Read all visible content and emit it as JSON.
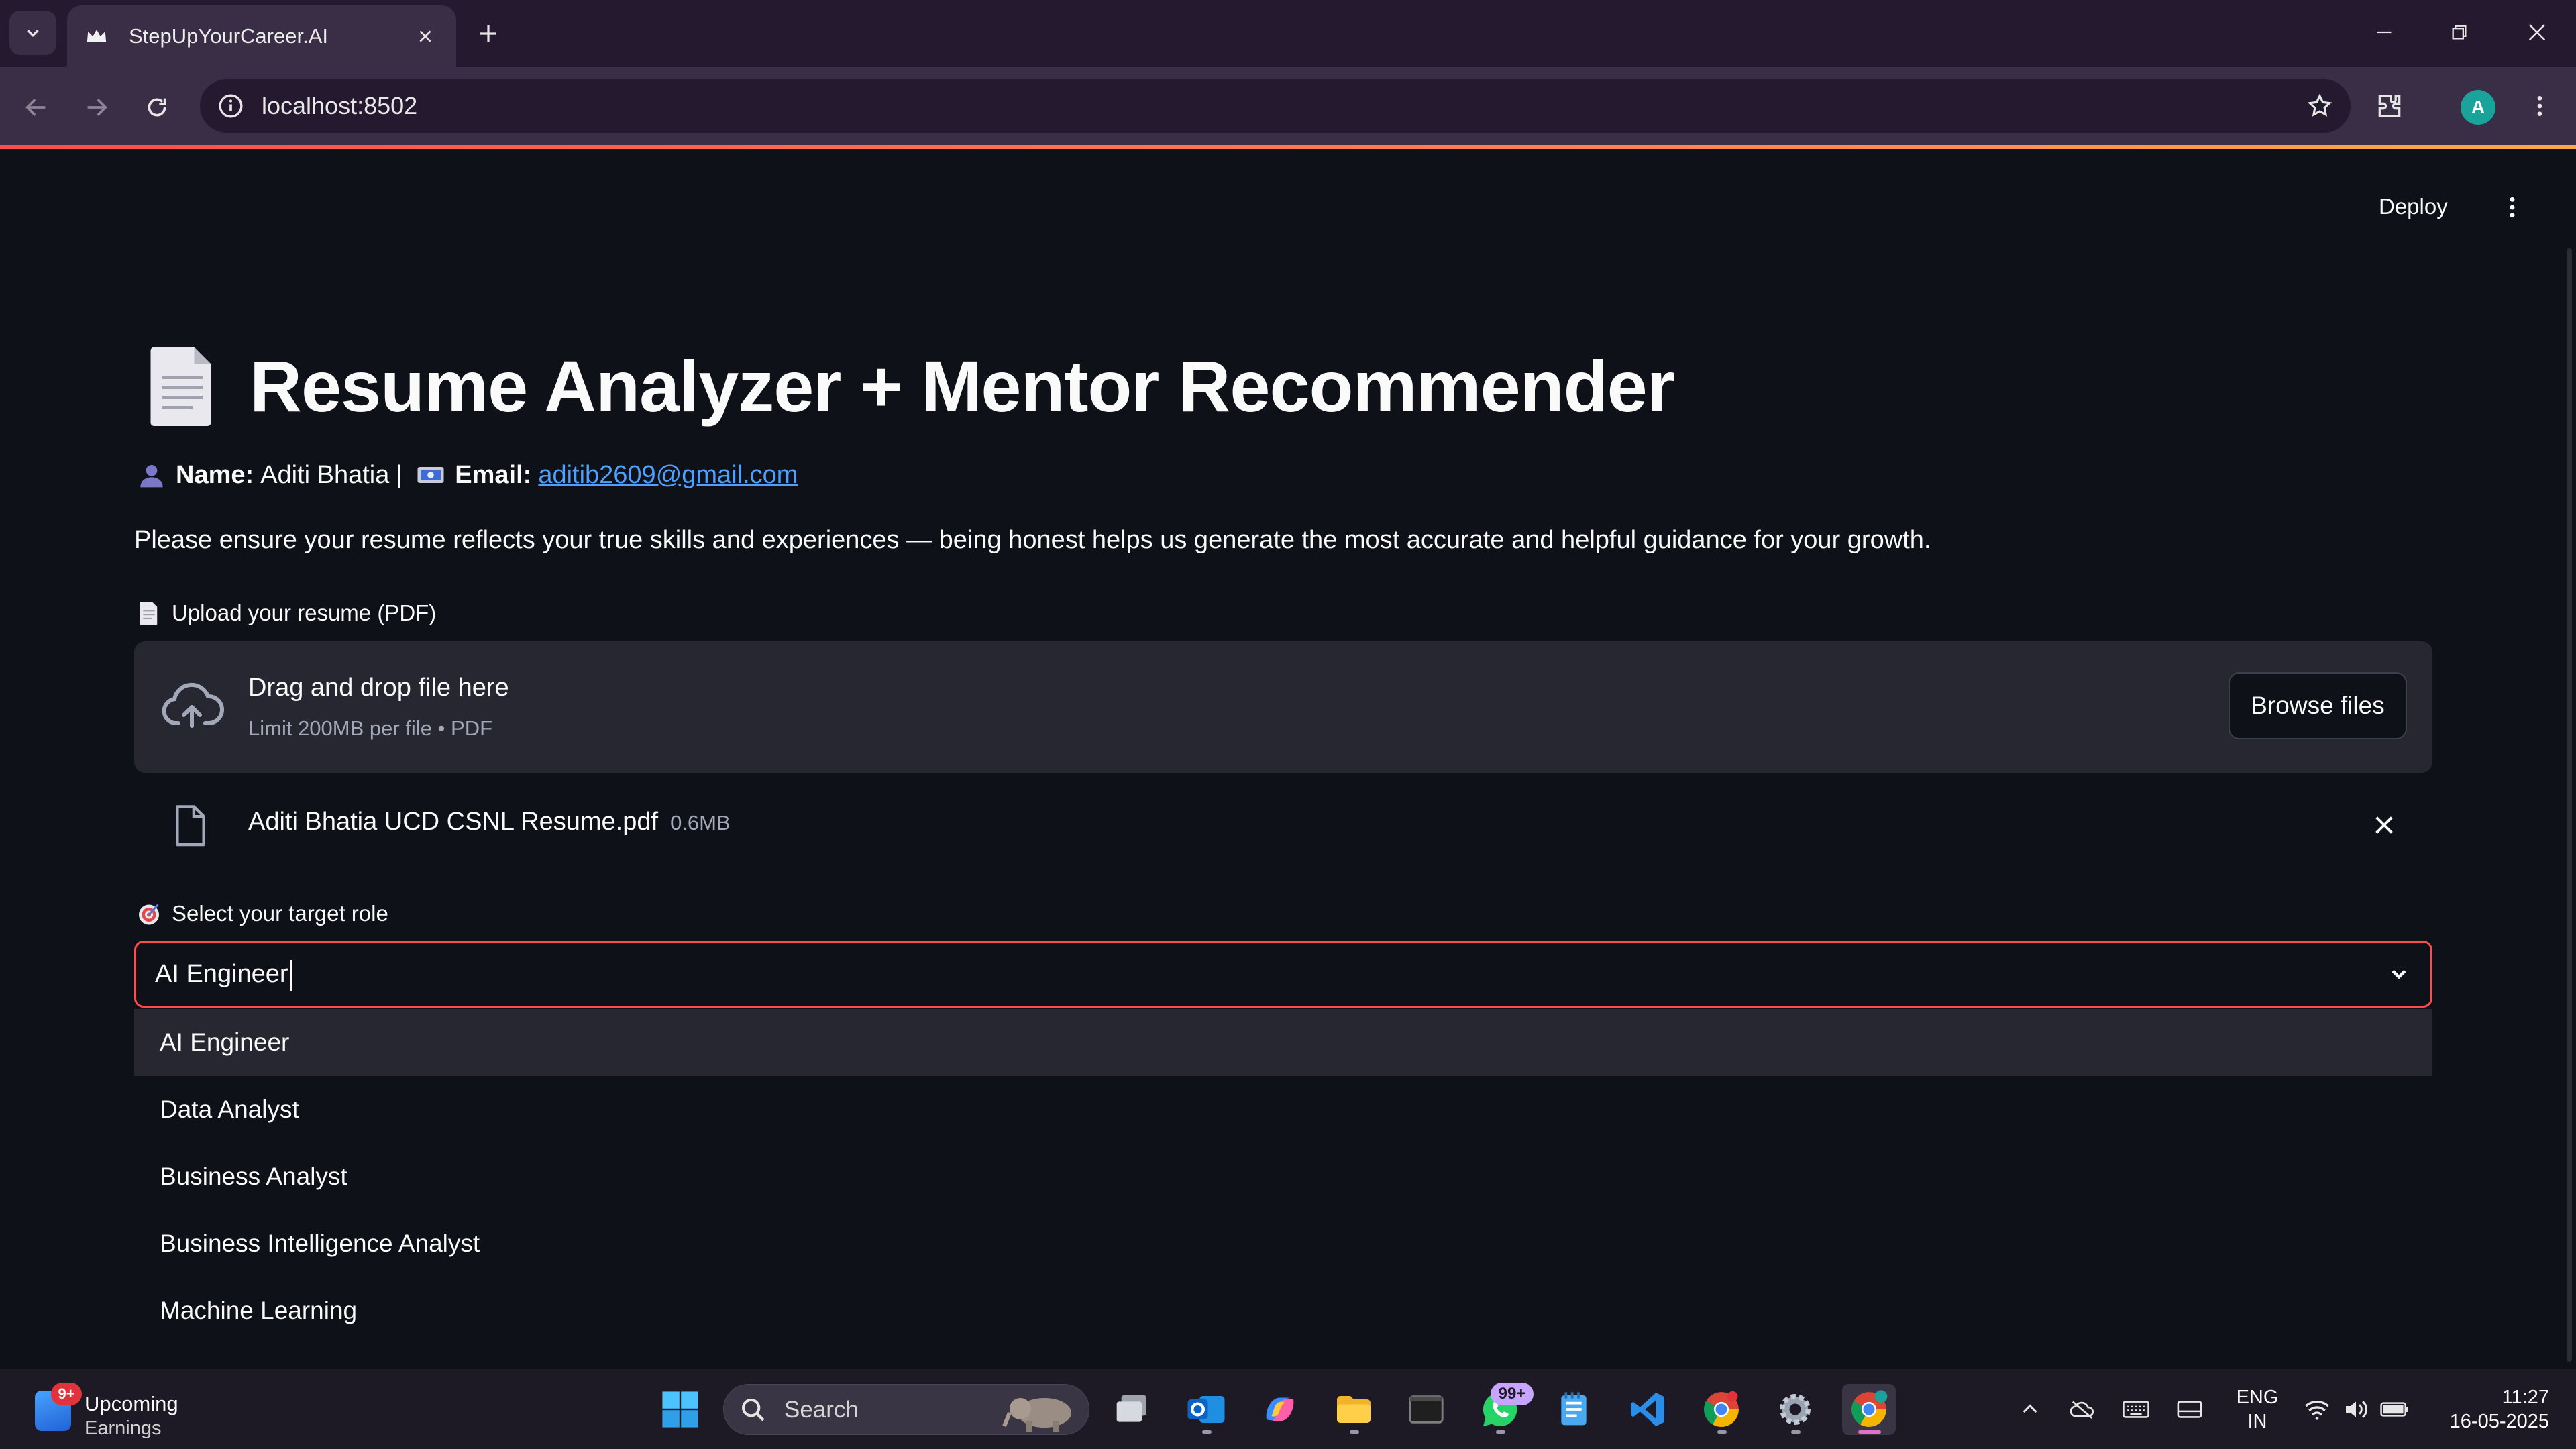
{
  "browser": {
    "tab_title": "StepUpYourCareer.AI",
    "url": "localhost:8502",
    "profile_initial": "A"
  },
  "app": {
    "deploy_label": "Deploy",
    "title": "Resume Analyzer + Mentor Recommender",
    "user": {
      "name_label": "Name:",
      "name": "Aditi Bhatia",
      "separator": "|",
      "email_label": "Email:",
      "email": "aditib2609@gmail.com"
    },
    "notice": "Please ensure your resume reflects your true skills and experiences — being honest helps us generate the most accurate and helpful guidance for your growth.",
    "upload": {
      "label": "Upload your resume (PDF)",
      "drag_text": "Drag and drop file here",
      "limit_text": "Limit 200MB per file • PDF",
      "browse_label": "Browse files",
      "file_name": "Aditi Bhatia UCD CSNL Resume.pdf",
      "file_size": "0.6MB"
    },
    "role_select": {
      "label": "Select your target role",
      "value": "AI Engineer",
      "options": [
        "AI Engineer",
        "Data Analyst",
        "Business Analyst",
        "Business Intelligence Analyst",
        "Machine Learning"
      ]
    }
  },
  "taskbar": {
    "news_badge": "9+",
    "news_line1": "Upcoming",
    "news_line2": "Earnings",
    "search_placeholder": "Search",
    "whatsapp_badge": "99+",
    "lang_line1": "ENG",
    "lang_line2": "IN",
    "time": "11:27",
    "date": "16-05-2025"
  },
  "colors": {
    "app_bg": "#0e1117",
    "accent": "#ff4b4b",
    "link": "#4ea1ff",
    "browser_frame": "#24192e",
    "browser_toolbar": "#3a2e46"
  },
  "icons": [
    "chevron-down-icon",
    "crown-favicon-icon",
    "close-icon",
    "plus-icon",
    "minimize-icon",
    "restore-icon",
    "back-icon",
    "forward-icon",
    "reload-icon",
    "info-icon",
    "star-icon",
    "extensions-icon",
    "kebab-menu-icon",
    "document-icon",
    "user-icon",
    "id-card-icon",
    "cloud-upload-icon",
    "file-icon",
    "target-icon",
    "windows-start-icon",
    "search-icon"
  ]
}
